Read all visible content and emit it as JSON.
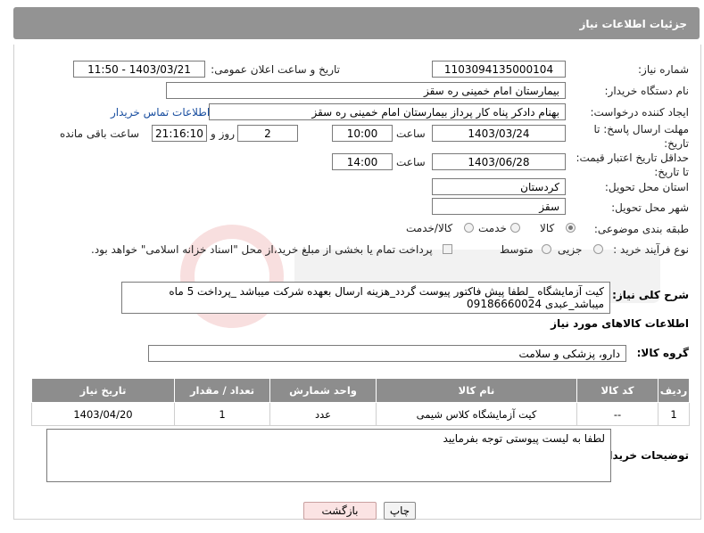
{
  "header": {
    "title": "جزئیات اطلاعات نیاز"
  },
  "fields": {
    "need_number_label": "شماره نیاز:",
    "need_number": "1103094135000104",
    "announce_label": "تاریخ و ساعت اعلان عمومی:",
    "announce_value": "1403/03/21 - 11:50",
    "buyer_label": "نام دستگاه خریدار:",
    "buyer_value": "بیمارستان امام خمینی  ره  سقز",
    "creator_label": "ایجاد کننده درخواست:",
    "creator_value": "بهنام دادکر پناه کار پرداز بیمارستان امام خمینی  ره  سقز",
    "contact_link": "اطلاعات تماس خریدار",
    "deadline_label": "مهلت ارسال پاسخ: تا تاریخ:",
    "deadline_date": "1403/03/24",
    "time_label": "ساعت",
    "deadline_time": "10:00",
    "days_value": "2",
    "days_label": "روز و",
    "remaining_time": "21:16:10",
    "remaining_label": "ساعت باقی مانده",
    "validity_label": "حداقل تاریخ اعتبار قیمت: تا تاریخ:",
    "validity_date": "1403/06/28",
    "validity_time_label": "ساعت",
    "validity_time": "14:00",
    "province_label": "استان محل تحویل:",
    "province_value": "کردستان",
    "city_label": "شهر محل تحویل:",
    "city_value": "سقز",
    "category_label": "طبقه بندی موضوعی:",
    "category_options": [
      "کالا",
      "خدمت",
      "کالا/خدمت"
    ],
    "process_label": "نوع فرآیند خرید :",
    "process_options": [
      "جزیی",
      "متوسط"
    ],
    "payment_note": "پرداخت تمام یا بخشی از مبلغ خرید،از محل \"اسناد خزانه اسلامی\" خواهد بود."
  },
  "description": {
    "label": "شرح کلی نیاز:",
    "text": "کیت آزمایشگاه _لطفا پیش فاکتور پیوست گردد_هزینه ارسال بعهده شرکت میباشد _پرداخت 5 ماه میباشد_عبدی 09186660024"
  },
  "goods_section": {
    "title": "اطلاعات کالاهای مورد نیاز",
    "group_label": "گروه کالا:",
    "group_value": "دارو، پزشکی و سلامت"
  },
  "table": {
    "headers": [
      "ردیف",
      "کد کالا",
      "نام کالا",
      "واحد شمارش",
      "تعداد / مقدار",
      "تاریخ نیاز"
    ],
    "rows": [
      [
        "1",
        "--",
        "کیت آزمایشگاه کلاس شیمی",
        "عدد",
        "1",
        "1403/04/20"
      ]
    ]
  },
  "buyer_notes": {
    "label": "توضیحات خریدار:",
    "text": "لطفا به لیست پیوستی توجه بفرمایید"
  },
  "buttons": {
    "print": "چاپ",
    "back": "بازگشت"
  },
  "colors": {
    "header_bg": "#939393",
    "link": "#1a4fa0",
    "table_header": "#8d8d8d"
  }
}
